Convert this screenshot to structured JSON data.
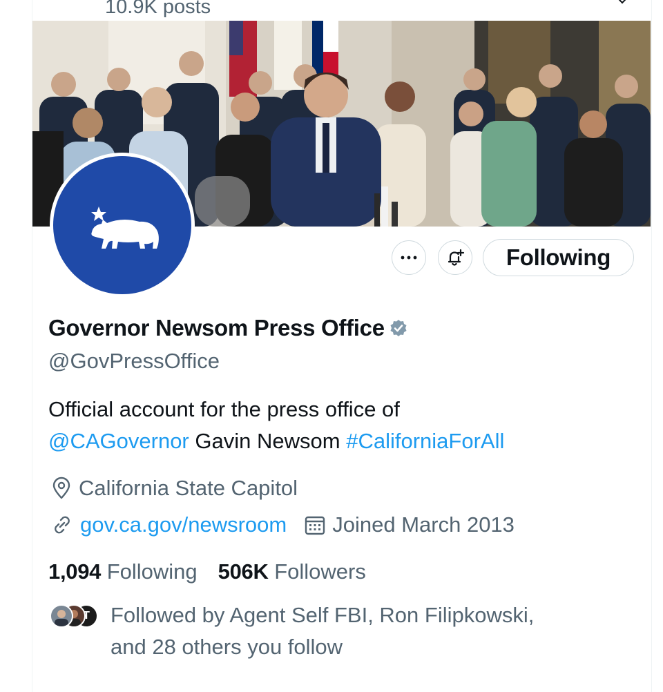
{
  "header": {
    "posts_count": "10.9K posts"
  },
  "profile": {
    "display_name": "Governor Newsom Press Office",
    "handle": "@GovPressOffice",
    "bio": {
      "text_1": "Official account for the press office of",
      "mention": "@CAGovernor",
      "text_2": "Gavin Newsom",
      "hashtag": "#CaliforniaForAll"
    },
    "location": "California State Capitol",
    "website": "gov.ca.gov/newsroom",
    "joined": "Joined March 2013",
    "following_count": "1,094",
    "following_label": "Following",
    "followers_count": "506K",
    "followers_label": "Followers",
    "followed_by_line1": "Followed by Agent Self FBI, Ron Filipkowski,",
    "followed_by_line2": "and 28 others you follow",
    "follower_avatar_initial": "T"
  },
  "actions": {
    "more": "···",
    "follow_state": "Following"
  },
  "icons": {
    "more": "more-icon",
    "notify": "bell-plus-icon",
    "verified": "verified-badge-icon",
    "location": "location-pin-icon",
    "link": "link-icon",
    "calendar": "calendar-icon",
    "avatar_logo": "bear-star-logo"
  },
  "colors": {
    "accent": "#1d9bf0",
    "secondary_text": "#536471",
    "avatar_bg": "#1f4aa8",
    "verified_badge": "#829aab",
    "button_border": "#cfd9de"
  }
}
